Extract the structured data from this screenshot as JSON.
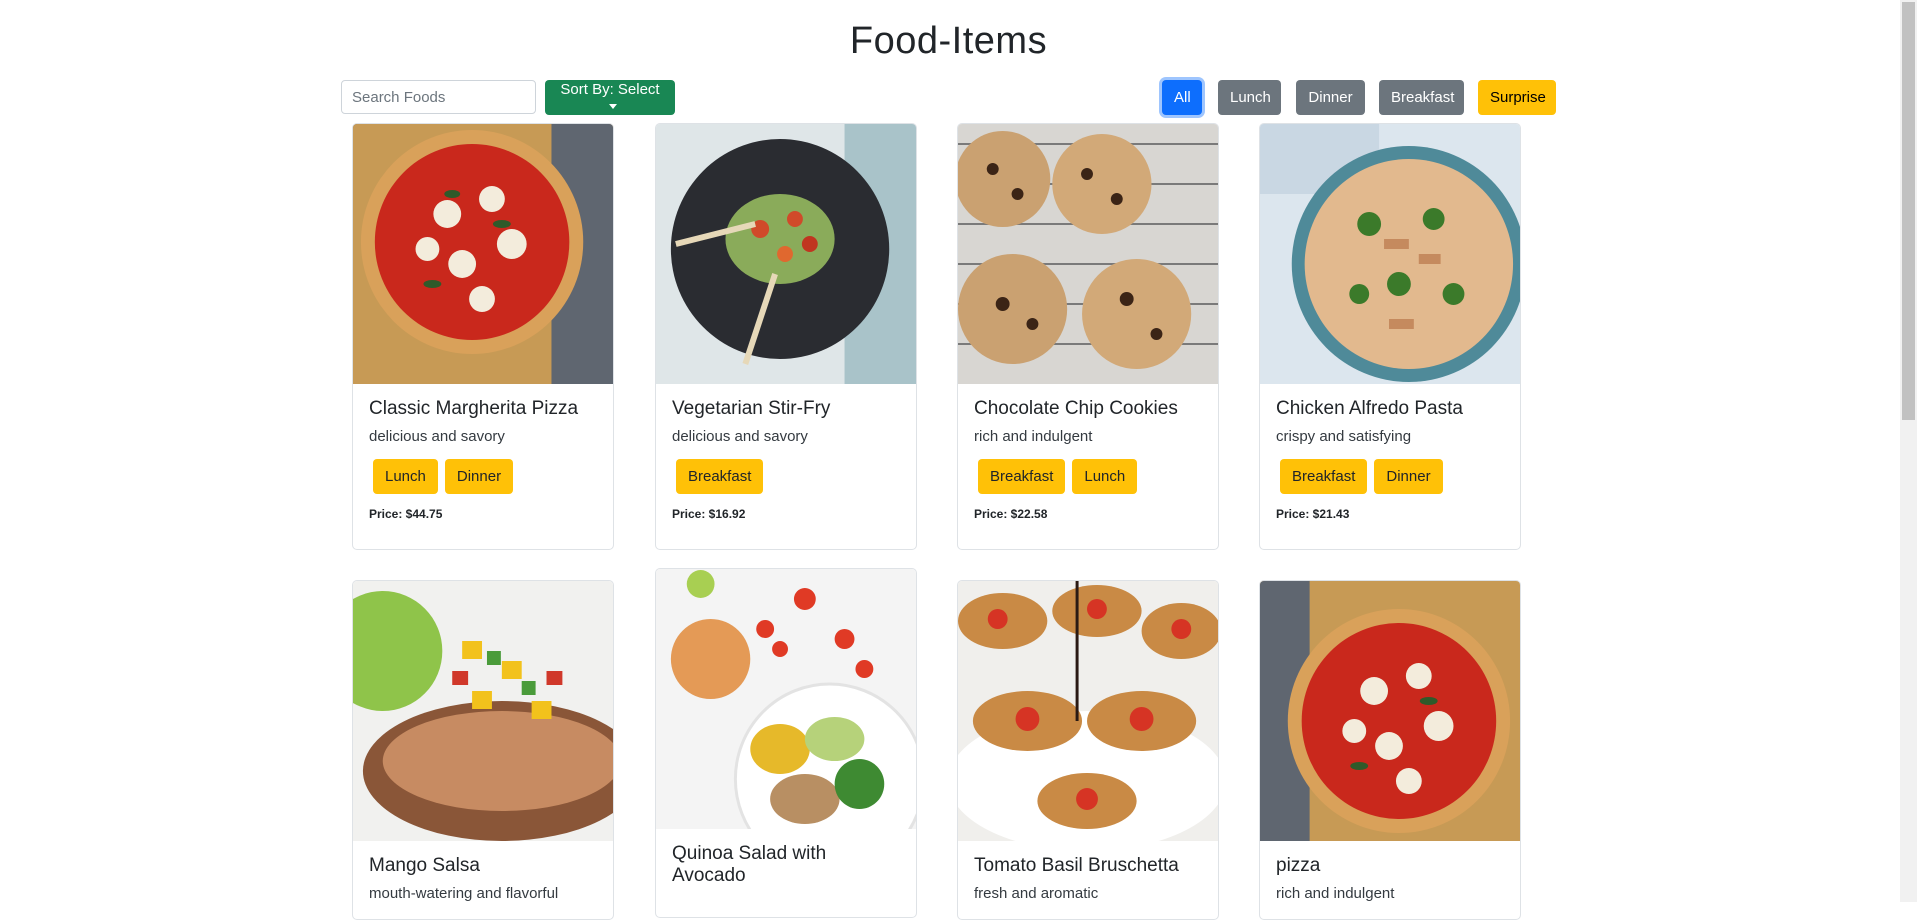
{
  "page": {
    "title": "Food-Items"
  },
  "search": {
    "placeholder": "Search Foods"
  },
  "sort": {
    "label": "Sort By: Select"
  },
  "filters": [
    "All",
    "Lunch",
    "Dinner",
    "Breakfast",
    "Surprise"
  ],
  "foods": [
    {
      "name": "Classic Margherita Pizza",
      "desc": "delicious and savory",
      "tags": [
        "Lunch",
        "Dinner"
      ],
      "price": "Price: $44.75"
    },
    {
      "name": "Vegetarian Stir-Fry",
      "desc": "delicious and savory",
      "tags": [
        "Breakfast"
      ],
      "price": "Price: $16.92"
    },
    {
      "name": "Chocolate Chip Cookies",
      "desc": "rich and indulgent",
      "tags": [
        "Breakfast",
        "Lunch"
      ],
      "price": "Price: $22.58"
    },
    {
      "name": "Chicken Alfredo Pasta",
      "desc": "crispy and satisfying",
      "tags": [
        "Breakfast",
        "Dinner"
      ],
      "price": "Price: $21.43"
    },
    {
      "name": "Mango Salsa",
      "desc": "mouth-watering and flavorful",
      "tags": [],
      "price": ""
    },
    {
      "name": "Quinoa Salad with Avocado",
      "desc": "",
      "tags": [],
      "price": ""
    },
    {
      "name": "Tomato Basil Bruschetta",
      "desc": "fresh and aromatic",
      "tags": [],
      "price": ""
    },
    {
      "name": "pizza",
      "desc": "rich and indulgent",
      "tags": [],
      "price": ""
    }
  ],
  "colors": {
    "primary": "#0d6efd",
    "success": "#198754",
    "secondary": "#6c757d",
    "warning": "#ffc107"
  }
}
